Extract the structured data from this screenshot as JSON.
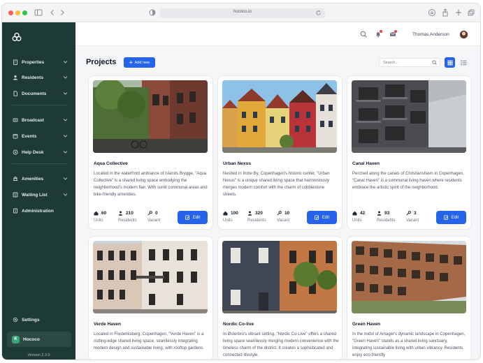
{
  "browser": {
    "url": "hococo.io"
  },
  "sidebar": {
    "logo": "hococo-logo-icon",
    "items": [
      {
        "label": "Properties",
        "icon": "building-icon"
      },
      {
        "label": "Residents",
        "icon": "person-icon"
      },
      {
        "label": "Documents",
        "icon": "document-icon"
      },
      {
        "label": "Broadcast",
        "icon": "broadcast-icon"
      },
      {
        "label": "Events",
        "icon": "calendar-icon"
      },
      {
        "label": "Help Desk",
        "icon": "chat-icon"
      },
      {
        "label": "Amenities",
        "icon": "amenities-icon"
      },
      {
        "label": "Waiting List",
        "icon": "list-icon"
      },
      {
        "label": "Administration",
        "icon": "admin-icon"
      }
    ],
    "settings_label": "Settings",
    "workspace": {
      "badge": "K",
      "name": "Hococo"
    },
    "version": "Version 2.3.0"
  },
  "topbar": {
    "user_name": "Thomas Anderson"
  },
  "main": {
    "title": "Projects",
    "add_label": "Add new",
    "search_placeholder": "Search..."
  },
  "colors": {
    "sidebar": "#1d3a35",
    "accent": "#2563eb"
  },
  "projects": [
    {
      "title": "Aqua Collective",
      "description": "Located in the waterfront ambiance of Islands Brygge, \"Aqua Collective\" is a shared living space embodying the neighborhood's modern flair. With sunlit communal areas and bike-friendly amenities.",
      "units": "60",
      "residents": "210",
      "vacant": "0",
      "units_label": "Units",
      "residents_label": "Residents",
      "vacant_label": "Vacant",
      "edit_label": "Edit"
    },
    {
      "title": "Urban Nexus",
      "description": "Nestled in Indre By, Copenhagen's historic center, \"Urban Nexus\" is a unique shared living space that harmoniously merges modern comfort with the charm of cobblestone streets.",
      "units": "100",
      "residents": "320",
      "vacant": "10",
      "units_label": "Units",
      "residents_label": "Residents",
      "vacant_label": "Vacant",
      "edit_label": "Edit"
    },
    {
      "title": "Canal Haven",
      "description": "Perched along the canals of Christianshavn in Copenhagen, \"Canal Haven\" is a communal living haven where residents embrace the artistic spirit of the neighborhood.",
      "units": "42",
      "residents": "93",
      "vacant": "3",
      "units_label": "Units",
      "residents_label": "Residents",
      "vacant_label": "Vacant",
      "edit_label": "Edit"
    },
    {
      "title": "Verde Haven",
      "description": "Located in Frederiksberg, Copenhagen, \"Verde Haven\" is a cutting-edge shared living space, seamlessly integrating modern design and sustainable living, with rooftop gardens."
    },
    {
      "title": "Nordic Co-live",
      "description": "In Østerbro's vibrant setting, \"Nordic Co-Live\" offers a shared living space seamlessly merging modern convenience with the timeless charm of the district. It creates a sophisticated and connected lifestyle."
    },
    {
      "title": "Green Haven",
      "description": "In the midst of Amager's dynamic landscape in Copenhagen, \"Green Haven\" stands as a shared living sanctuary, integrating sustainable living with urban vibrancy. Residents enjoy eco-friendly"
    }
  ]
}
